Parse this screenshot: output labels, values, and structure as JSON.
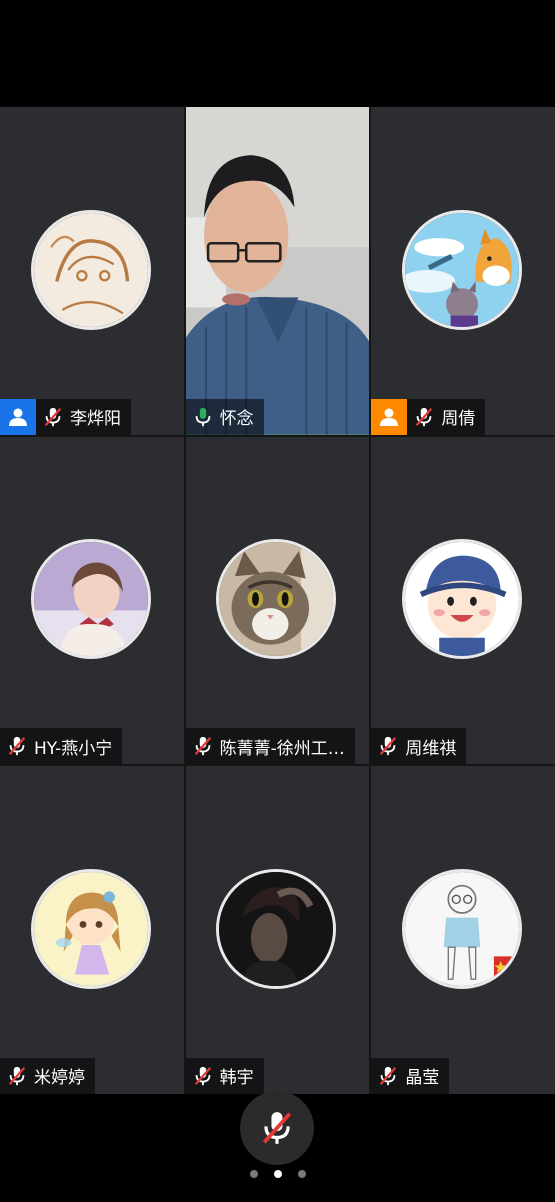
{
  "participants": [
    {
      "name": "李烨阳",
      "host": true,
      "host_color": "#1a73e8",
      "mic": "muted",
      "avatar": "anime-sketch"
    },
    {
      "name": "怀念",
      "host": false,
      "mic": "active",
      "video": true
    },
    {
      "name": "周倩",
      "host": true,
      "host_color": "#ff8a00",
      "mic": "muted",
      "avatar": "cartoon-dog-cat"
    },
    {
      "name": "HY-燕小宁",
      "host": false,
      "mic": "muted",
      "avatar": "girl-photo"
    },
    {
      "name": "陈菁菁-徐州工…",
      "host": false,
      "mic": "muted",
      "avatar": "cat-photo"
    },
    {
      "name": "周维祺",
      "host": false,
      "mic": "muted",
      "avatar": "cartoon-boy"
    },
    {
      "name": "米婷婷",
      "host": false,
      "mic": "muted",
      "avatar": "anime-girl"
    },
    {
      "name": "韩宇",
      "host": false,
      "mic": "muted",
      "avatar": "dark-portrait"
    },
    {
      "name": "晶莹",
      "host": false,
      "mic": "muted",
      "avatar": "sketch-girl"
    }
  ],
  "controls": {
    "mute_icon": "mic-muted-icon"
  },
  "pager": {
    "pages": 3,
    "current": 2
  },
  "colors": {
    "active_border": "#2fae5a",
    "muted_red": "#e53935",
    "mic_green": "#2fae5a"
  }
}
